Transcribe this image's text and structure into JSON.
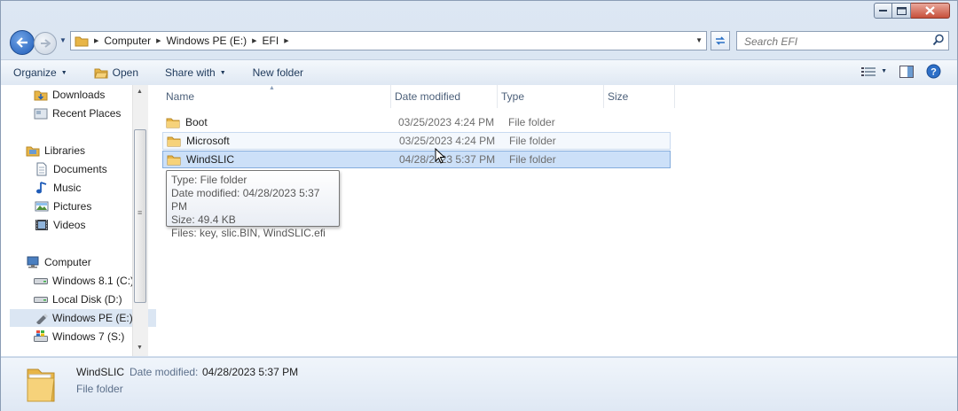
{
  "window": {
    "caption_buttons": [
      "minimize",
      "maximize",
      "close"
    ]
  },
  "nav": {
    "breadcrumbs": [
      "Computer",
      "Windows PE (E:)",
      "EFI"
    ],
    "search_placeholder": "Search EFI"
  },
  "toolbar": {
    "organize": "Organize",
    "open": "Open",
    "share_with": "Share with",
    "new_folder": "New folder"
  },
  "sidebar": {
    "items": [
      {
        "label": "Downloads",
        "icon": "downloads-icon"
      },
      {
        "label": "Recent Places",
        "icon": "recent-places-icon"
      },
      {
        "label": "Libraries",
        "icon": "libraries-icon"
      },
      {
        "label": "Documents",
        "icon": "documents-icon"
      },
      {
        "label": "Music",
        "icon": "music-icon"
      },
      {
        "label": "Pictures",
        "icon": "pictures-icon"
      },
      {
        "label": "Videos",
        "icon": "videos-icon"
      },
      {
        "label": "Computer",
        "icon": "computer-icon"
      },
      {
        "label": "Windows 8.1 (C:)",
        "icon": "drive-icon"
      },
      {
        "label": "Local Disk (D:)",
        "icon": "drive-icon"
      },
      {
        "label": "Windows PE (E:)",
        "icon": "usb-drive-icon",
        "selected": true
      },
      {
        "label": "Windows 7 (S:)",
        "icon": "windows-drive-icon"
      }
    ]
  },
  "file_list": {
    "columns": [
      "Name",
      "Date modified",
      "Type",
      "Size"
    ],
    "rows": [
      {
        "name": "Boot",
        "date": "03/25/2023 4:24 PM",
        "type": "File folder",
        "size": "",
        "state": "normal"
      },
      {
        "name": "Microsoft",
        "date": "03/25/2023 4:24 PM",
        "type": "File folder",
        "size": "",
        "state": "hover"
      },
      {
        "name": "WindSLIC",
        "date": "04/28/2023 5:37 PM",
        "type": "File folder",
        "size": "",
        "state": "selected"
      }
    ]
  },
  "tooltip": {
    "lines": [
      "Type: File folder",
      "Date modified: 04/28/2023 5:37 PM",
      "Size: 49.4 KB",
      "Files: key, slic.BIN, WindSLIC.efi"
    ]
  },
  "details": {
    "name": "WindSLIC",
    "date_label": "Date modified:",
    "date_value": "04/28/2023 5:37 PM",
    "type": "File folder"
  },
  "colors": {
    "selection": "#cce0f8",
    "hover": "#f4f8fd",
    "folder": "#f3c75b"
  }
}
